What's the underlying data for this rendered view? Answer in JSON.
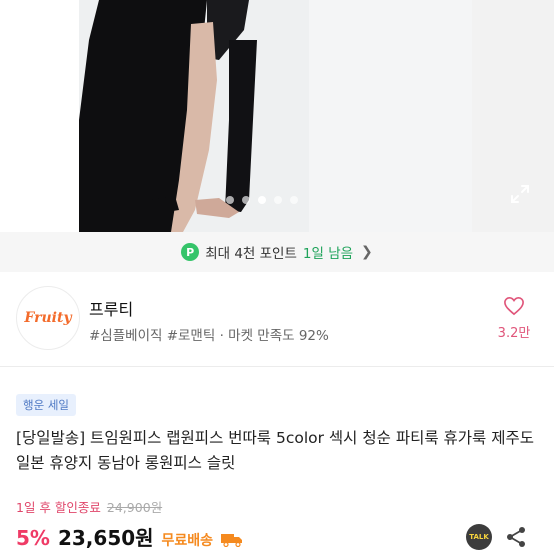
{
  "gallery": {
    "image_alt": "black wrap slip dress photo",
    "dots": 5,
    "active_dot": 3,
    "expand_icon": "expand-icon"
  },
  "points_banner": {
    "icon": "P",
    "text": "최대 4천 포인트",
    "highlight": "1일 남음",
    "chevron": "❯"
  },
  "shop": {
    "logo_text": "Fruity",
    "name": "프루티",
    "tags": "#심플베이직 #로맨틱 · 마켓 만족도 92%",
    "favorite_count": "3.2만",
    "colors": {
      "favorite": "#e0557a",
      "logo": "#f36b2b"
    }
  },
  "product": {
    "badge": "행운 세일",
    "title": "[당일발송] 트임원피스 랩원피스 번따룩 5color 섹시 청순 파티룩 휴가룩 제주도 일본 휴양지 동남아 롱원피스 슬릿",
    "deadline": "1일 후 할인종료",
    "original_price": "24,900원",
    "discount": "5%",
    "price": "23,650원",
    "shipping": "무료배송",
    "talk_label": "TALK",
    "colors": {
      "discount": "#ef3b66",
      "shipping": "#f58a1f",
      "points": "#35c46a"
    }
  }
}
